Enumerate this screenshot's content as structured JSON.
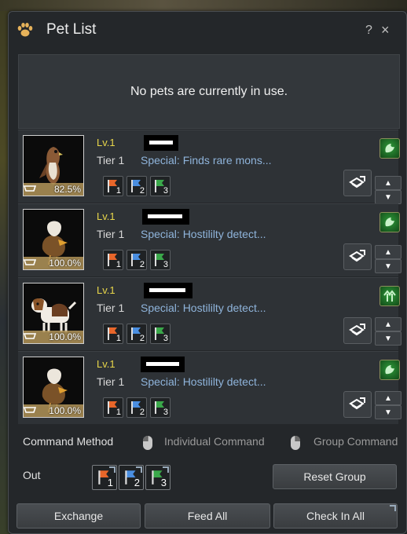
{
  "window": {
    "title": "Pet List",
    "help_label": "?",
    "close_label": "×"
  },
  "status": {
    "message": "No pets are currently in use."
  },
  "pets": [
    {
      "level": "Lv.1",
      "tier": "Tier 1",
      "special": "Special: Finds rare mons...",
      "food_pct": "82.5%",
      "skill_icon": "skill-hunt-icon",
      "portrait": "hawk"
    },
    {
      "level": "Lv.1",
      "tier": "Tier 1",
      "special": "Special: Hostililty detect...",
      "food_pct": "100.0%",
      "skill_icon": "skill-hunt-icon",
      "portrait": "dodo-egg"
    },
    {
      "level": "Lv.1",
      "tier": "Tier 1",
      "special": "Special: Hostililty detect...",
      "food_pct": "100.0%",
      "skill_icon": "skill-growth-icon",
      "portrait": "beagle"
    },
    {
      "level": "Lv.1",
      "tier": "Tier 1",
      "special": "Special: Hostililty detect...",
      "food_pct": "100.0%",
      "skill_icon": "skill-hunt-icon",
      "portrait": "dodo-egg"
    }
  ],
  "flags": [
    {
      "num": "1",
      "color": "#e8662a"
    },
    {
      "num": "2",
      "color": "#4a8ee0"
    },
    {
      "num": "3",
      "color": "#3aa84a"
    }
  ],
  "command": {
    "label": "Command Method",
    "individual_label": "Individual Command",
    "group_label": "Group Command"
  },
  "out": {
    "label": "Out"
  },
  "buttons": {
    "reset_group": "Reset Group",
    "exchange": "Exchange",
    "feed_all": "Feed All",
    "check_in_all": "Check In All"
  },
  "colors": {
    "level": "#e8d64a",
    "special": "#8fb4db",
    "panel": "#24272a"
  }
}
